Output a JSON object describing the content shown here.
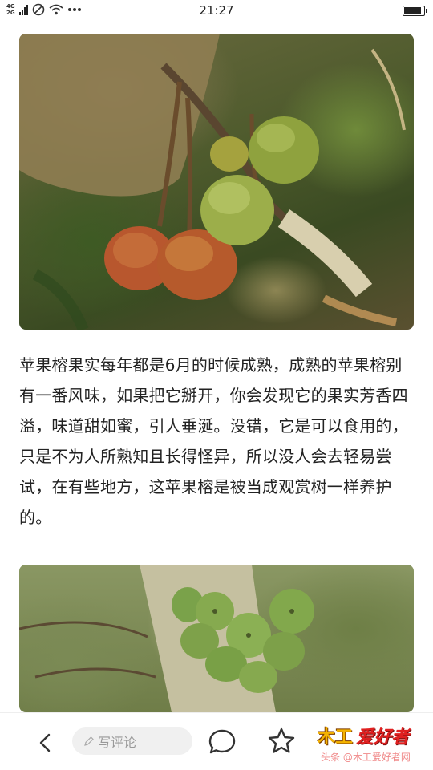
{
  "status_bar": {
    "network_top": "4G",
    "network_bottom": "2G",
    "time": "21:27",
    "battery_level": 0.8
  },
  "article": {
    "paragraph": "苹果榕果实每年都是6月的时候成熟，成熟的苹果榕别有一番风味，如果把它掰开，你会发现它的果实芳香四溢，味道甜如蜜，引人垂涎。没错，它是可以食用的，只是不为人所熟知且长得怪异，所以没人会去轻易尝试，在有些地方，这苹果榕是被当成观赏树一样养护的。"
  },
  "bottom_bar": {
    "comment_placeholder": "写评论",
    "logo_badge": "木工",
    "logo_text": "爱好者",
    "logo_sub": "头条 @木工爱好者网"
  },
  "icons": {
    "back": "chevron-left-icon",
    "comment": "speech-bubble-icon",
    "favorite": "star-icon",
    "edit": "pencil-icon",
    "signal": "signal-icon",
    "do_not_disturb": "do-not-disturb-icon",
    "wifi": "wifi-icon",
    "more": "more-icon",
    "battery": "battery-icon"
  },
  "colors": {
    "text": "#222222",
    "placeholder": "#999999",
    "logo_red": "#e02020",
    "logo_gold": "#f5b400"
  }
}
